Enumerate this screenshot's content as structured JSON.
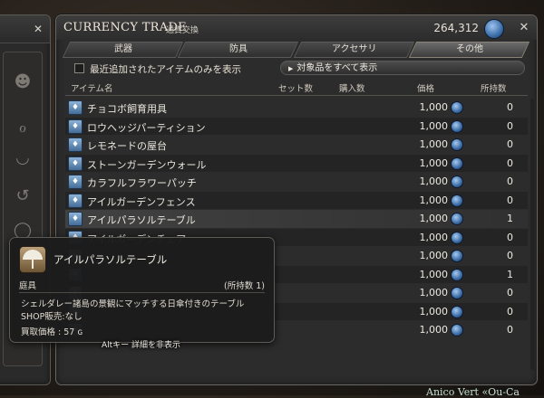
{
  "window": {
    "title": "CURRENCY TRADE",
    "subtitle": "通貨交換",
    "currency_amount": "264,312",
    "currency_icon": "gil-icon"
  },
  "tabs": [
    {
      "label": "武器",
      "active": false
    },
    {
      "label": "防具",
      "active": false
    },
    {
      "label": "アクセサリ",
      "active": false
    },
    {
      "label": "その他",
      "active": true
    }
  ],
  "filters": {
    "recent_only_label": "最近追加されたアイテムのみを表示",
    "recent_only_checked": false,
    "show_all_label": "対象品をすべて表示"
  },
  "table": {
    "headers": [
      "アイテム名",
      "セット数",
      "購入数",
      "価格",
      "所持数"
    ],
    "rows": [
      {
        "name": "チョコボ飼育用具",
        "price": "1,000",
        "owned": "0"
      },
      {
        "name": "ロウヘッジパーティション",
        "price": "1,000",
        "owned": "0"
      },
      {
        "name": "レモネードの屋台",
        "price": "1,000",
        "owned": "0"
      },
      {
        "name": "ストーンガーデンウォール",
        "price": "1,000",
        "owned": "0"
      },
      {
        "name": "カラフルフラワーパッチ",
        "price": "1,000",
        "owned": "0"
      },
      {
        "name": "アイルガーデンフェンス",
        "price": "1,000",
        "owned": "0"
      },
      {
        "name": "アイルパラソルテーブル",
        "price": "1,000",
        "owned": "1"
      },
      {
        "name": "アイルガーデンチェア",
        "price": "1,000",
        "owned": "0"
      },
      {
        "name": "",
        "price": "1,000",
        "owned": "0"
      },
      {
        "name": "",
        "price": "1,000",
        "owned": "1"
      },
      {
        "name": "",
        "price": "1,000",
        "owned": "0"
      },
      {
        "name": "",
        "price": "1,000",
        "owned": "0"
      },
      {
        "name": "",
        "price": "1,000",
        "owned": "0"
      }
    ]
  },
  "tooltip": {
    "item_name": "アイルパラソルテーブル",
    "category": "庭具",
    "owned": "(所持数 1)",
    "description": "シェルダレー諸島の景観にマッチする日傘付きのテーブル",
    "shop": "SHOP販売:なし",
    "sell_price": "買取価格 : 57 ɢ",
    "alt_hint": "Altキー 詳細を非表示"
  },
  "background": {
    "bottom_text": "Anico Vert «Ou-Ca"
  }
}
